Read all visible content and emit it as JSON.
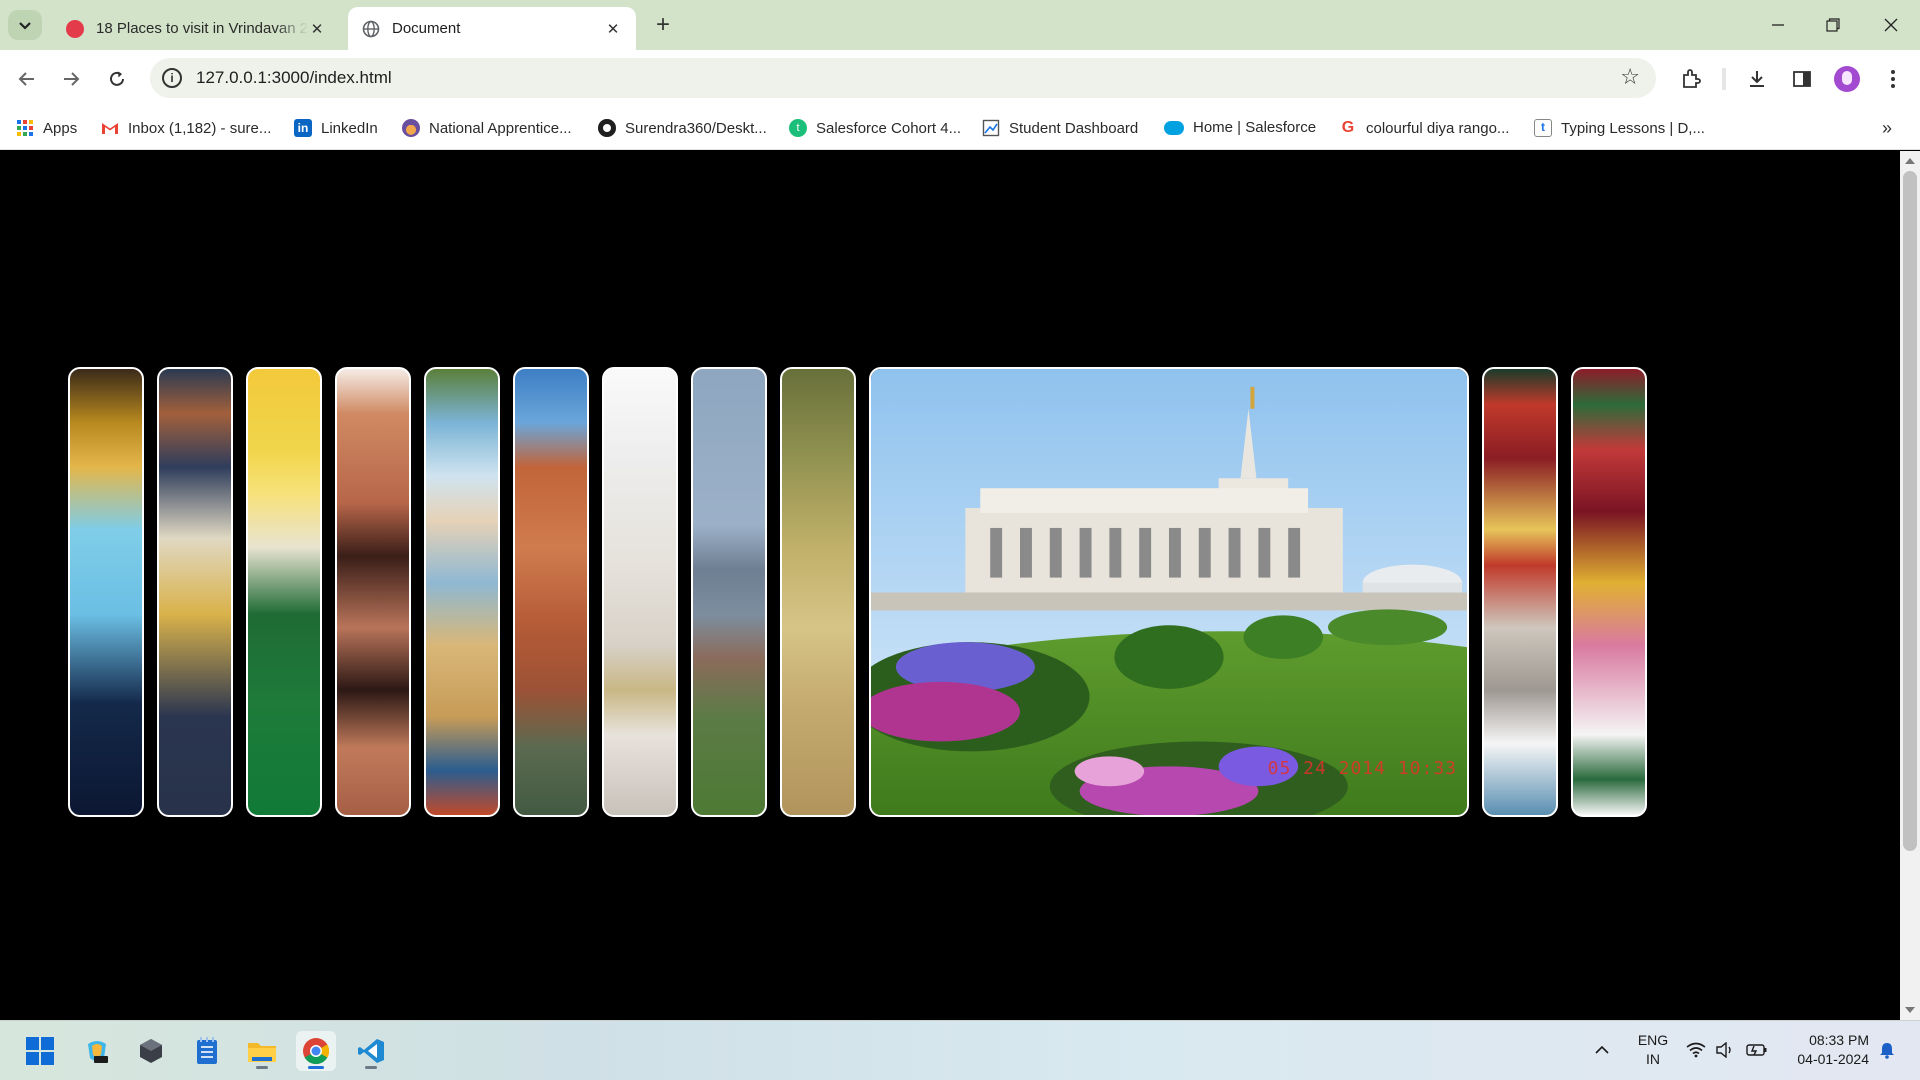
{
  "browser": {
    "tabs": [
      {
        "title": "18 Places to visit in Vrindavan 2",
        "favicon_color": "#e43b4b",
        "active": false
      },
      {
        "title": "Document",
        "favicon_color": "#5f6368",
        "active": true
      }
    ],
    "url": "127.0.0.1:3000/index.html",
    "bookmarks": [
      {
        "label": "Apps",
        "icon": "apps-grid-icon"
      },
      {
        "label": "Inbox (1,182) - sure...",
        "icon": "gmail-icon"
      },
      {
        "label": "LinkedIn",
        "icon": "linkedin-icon"
      },
      {
        "label": "National Apprentice...",
        "icon": "national-apprentice-icon"
      },
      {
        "label": "Surendra360/Deskt...",
        "icon": "github-icon"
      },
      {
        "label": "Salesforce Cohort 4...",
        "icon": "talentsprint-icon"
      },
      {
        "label": "Student Dashboard",
        "icon": "student-dashboard-icon"
      },
      {
        "label": "Home | Salesforce",
        "icon": "salesforce-icon"
      },
      {
        "label": "colourful diya rango...",
        "icon": "google-icon"
      },
      {
        "label": "Typing Lessons | D,...",
        "icon": "typing-icon"
      }
    ]
  },
  "gallery": {
    "images": [
      {
        "label": "krishna-portrait",
        "active": false
      },
      {
        "label": "krishna-painting",
        "active": false
      },
      {
        "label": "goddess-lotus",
        "active": false
      },
      {
        "label": "red-sandstone-haveli",
        "active": false
      },
      {
        "label": "temple-domes",
        "active": false
      },
      {
        "label": "ghat-building",
        "active": false
      },
      {
        "label": "white-temple-steps",
        "active": false
      },
      {
        "label": "city-skyline",
        "active": false
      },
      {
        "label": "forest-path",
        "active": false
      },
      {
        "label": "prem-mandir",
        "active": true,
        "date_stamp": "05 24 2014 10:33"
      },
      {
        "label": "decorated-shrine",
        "active": false
      },
      {
        "label": "flower-altar",
        "active": false
      }
    ]
  },
  "taskbar": {
    "apps": [
      "windows-start-icon",
      "copilot-icon",
      "app-cube-icon",
      "notepad-icon",
      "file-explorer-icon",
      "chrome-icon",
      "vscode-icon"
    ],
    "language_line1": "ENG",
    "language_line2": "IN",
    "time": "08:33 PM",
    "date": "04-01-2024"
  }
}
